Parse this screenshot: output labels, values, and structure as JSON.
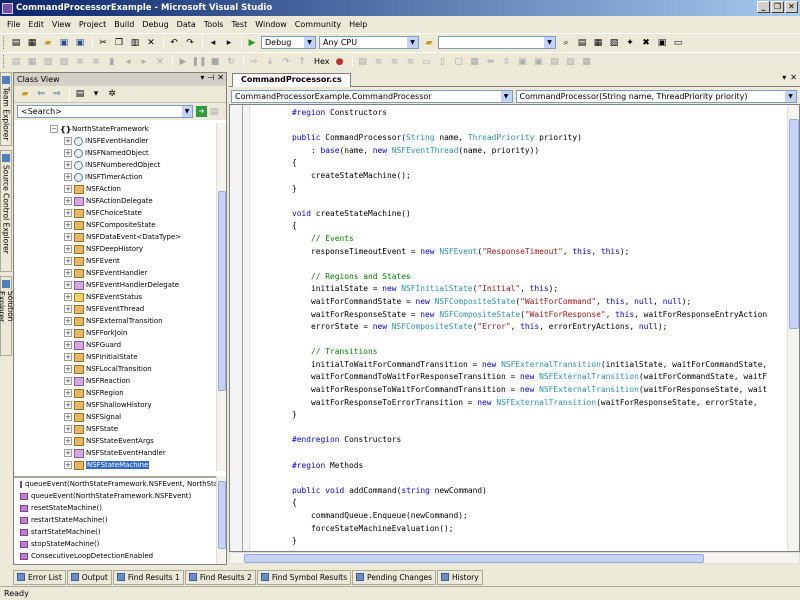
{
  "window": {
    "title": "CommandProcessorExample - Microsoft Visual Studio"
  },
  "menu": [
    "File",
    "Edit",
    "View",
    "Project",
    "Build",
    "Debug",
    "Data",
    "Tools",
    "Test",
    "Window",
    "Community",
    "Help"
  ],
  "toolbar": {
    "configuration": "Debug",
    "platform": "Any CPU",
    "hex_label": "Hex"
  },
  "class_view": {
    "title": "Class View",
    "search_placeholder": "<Search>",
    "namespace": "NorthStateFramework",
    "items": [
      {
        "label": "INSFEventHandler",
        "kind": "iface"
      },
      {
        "label": "INSFNamedObject",
        "kind": "iface"
      },
      {
        "label": "INSFNumberedObject",
        "kind": "iface"
      },
      {
        "label": "INSFTimerAction",
        "kind": "iface"
      },
      {
        "label": "NSFAction",
        "kind": "deleg"
      },
      {
        "label": "NSFActionDelegate",
        "kind": "class"
      },
      {
        "label": "NSFChoiceState",
        "kind": "deleg"
      },
      {
        "label": "NSFCompositeState",
        "kind": "deleg"
      },
      {
        "label": "NSFDataEvent<DataType>",
        "kind": "deleg"
      },
      {
        "label": "NSFDeepHistory",
        "kind": "deleg"
      },
      {
        "label": "NSFEvent",
        "kind": "deleg"
      },
      {
        "label": "NSFEventHandler",
        "kind": "deleg"
      },
      {
        "label": "NSFEventHandlerDelegate",
        "kind": "class"
      },
      {
        "label": "NSFEventStatus",
        "kind": "enum"
      },
      {
        "label": "NSFEventThread",
        "kind": "deleg"
      },
      {
        "label": "NSFExternalTransition",
        "kind": "deleg"
      },
      {
        "label": "NSFForkJoin",
        "kind": "deleg"
      },
      {
        "label": "NSFGuard",
        "kind": "class"
      },
      {
        "label": "NSFInitialState",
        "kind": "deleg"
      },
      {
        "label": "NSFLocalTransition",
        "kind": "deleg"
      },
      {
        "label": "NSFReaction",
        "kind": "class"
      },
      {
        "label": "NSFRegion",
        "kind": "deleg"
      },
      {
        "label": "NSFShallowHistory",
        "kind": "deleg"
      },
      {
        "label": "NSFSignal",
        "kind": "deleg"
      },
      {
        "label": "NSFState",
        "kind": "deleg"
      },
      {
        "label": "NSFStateEventArgs",
        "kind": "deleg"
      },
      {
        "label": "NSFStateEventHandler",
        "kind": "class"
      },
      {
        "label": "NSFStateMachine",
        "kind": "deleg",
        "selected": true
      }
    ],
    "members": [
      "queueEvent(NorthStateFramework.NSFEvent, NorthStateF",
      "queueEvent(NorthStateFramework.NSFEvent)",
      "resetStateMachine()",
      "restartStateMachine()",
      "startStateMachine()",
      "stopStateMachine()",
      "ConsecutiveLoopDetectionEnabled"
    ]
  },
  "side_tabs": [
    "Team Explorer",
    "Source Control Explorer",
    "Solution Explorer"
  ],
  "editor": {
    "tab": "CommandProcessor.cs",
    "type_combo": "CommandProcessorExample.CommandProcessor",
    "member_combo": "CommandProcessor(String name, ThreadPriority priority)",
    "lines": [
      [
        [
          "        ",
          ""
        ],
        [
          "#region",
          "kw"
        ],
        [
          " Constructors",
          ""
        ]
      ],
      [
        [
          "",
          ""
        ]
      ],
      [
        [
          "        ",
          ""
        ],
        [
          "public",
          "kw"
        ],
        [
          " CommandProcessor(",
          ""
        ],
        [
          "String",
          "ty"
        ],
        [
          " name, ",
          ""
        ],
        [
          "ThreadPriority",
          "ty"
        ],
        [
          " priority)",
          ""
        ]
      ],
      [
        [
          "            : ",
          ""
        ],
        [
          "base",
          "kw"
        ],
        [
          "(name, ",
          ""
        ],
        [
          "new",
          "kw"
        ],
        [
          " ",
          ""
        ],
        [
          "NSFEventThread",
          "ty"
        ],
        [
          "(name, priority))",
          ""
        ]
      ],
      [
        [
          "        {",
          ""
        ]
      ],
      [
        [
          "            createStateMachine();",
          ""
        ]
      ],
      [
        [
          "        }",
          ""
        ]
      ],
      [
        [
          "",
          ""
        ]
      ],
      [
        [
          "        ",
          ""
        ],
        [
          "void",
          "kw"
        ],
        [
          " createStateMachine()",
          ""
        ]
      ],
      [
        [
          "        {",
          ""
        ]
      ],
      [
        [
          "            ",
          ""
        ],
        [
          "// Events",
          "cm"
        ]
      ],
      [
        [
          "            responseTimeoutEvent = ",
          ""
        ],
        [
          "new",
          "kw"
        ],
        [
          " ",
          ""
        ],
        [
          "NSFEvent",
          "ty"
        ],
        [
          "(",
          ""
        ],
        [
          "\"ResponseTimeout\"",
          "st"
        ],
        [
          ", ",
          ""
        ],
        [
          "this",
          "kw"
        ],
        [
          ", ",
          ""
        ],
        [
          "this",
          "kw"
        ],
        [
          ");",
          ""
        ]
      ],
      [
        [
          "",
          ""
        ]
      ],
      [
        [
          "            ",
          ""
        ],
        [
          "// Regions and States",
          "cm"
        ]
      ],
      [
        [
          "            initialState = ",
          ""
        ],
        [
          "new",
          "kw"
        ],
        [
          " ",
          ""
        ],
        [
          "NSFInitialState",
          "ty"
        ],
        [
          "(",
          ""
        ],
        [
          "\"Initial\"",
          "st"
        ],
        [
          ", ",
          ""
        ],
        [
          "this",
          "kw"
        ],
        [
          ");",
          ""
        ]
      ],
      [
        [
          "            waitForCommandState = ",
          ""
        ],
        [
          "new",
          "kw"
        ],
        [
          " ",
          ""
        ],
        [
          "NSFCompositeState",
          "ty"
        ],
        [
          "(",
          ""
        ],
        [
          "\"WaitForCommand\"",
          "st"
        ],
        [
          ", ",
          ""
        ],
        [
          "this",
          "kw"
        ],
        [
          ", ",
          ""
        ],
        [
          "null",
          "kw"
        ],
        [
          ", ",
          ""
        ],
        [
          "null",
          "kw"
        ],
        [
          ");",
          ""
        ]
      ],
      [
        [
          "            waitForResponseState = ",
          ""
        ],
        [
          "new",
          "kw"
        ],
        [
          " ",
          ""
        ],
        [
          "NSFCompositeState",
          "ty"
        ],
        [
          "(",
          ""
        ],
        [
          "\"WaitForResponse\"",
          "st"
        ],
        [
          ", ",
          ""
        ],
        [
          "this",
          "kw"
        ],
        [
          ", waitForResponseEntryAction",
          ""
        ]
      ],
      [
        [
          "            errorState = ",
          ""
        ],
        [
          "new",
          "kw"
        ],
        [
          " ",
          ""
        ],
        [
          "NSFCompositeState",
          "ty"
        ],
        [
          "(",
          ""
        ],
        [
          "\"Error\"",
          "st"
        ],
        [
          ", ",
          ""
        ],
        [
          "this",
          "kw"
        ],
        [
          ", errorEntryActions, ",
          ""
        ],
        [
          "null",
          "kw"
        ],
        [
          ");",
          ""
        ]
      ],
      [
        [
          "",
          ""
        ]
      ],
      [
        [
          "            ",
          ""
        ],
        [
          "// Transitions",
          "cm"
        ]
      ],
      [
        [
          "            initialToWaitForCommandTransition = ",
          ""
        ],
        [
          "new",
          "kw"
        ],
        [
          " ",
          ""
        ],
        [
          "NSFExternalTransition",
          "ty"
        ],
        [
          "(initialState, waitForCommandState,",
          ""
        ]
      ],
      [
        [
          "            waitForCommandToWaitForResponseTransition = ",
          ""
        ],
        [
          "new",
          "kw"
        ],
        [
          " ",
          ""
        ],
        [
          "NSFExternalTransition",
          "ty"
        ],
        [
          "(waitForCommandState, waitF",
          ""
        ]
      ],
      [
        [
          "            waitForResponseToWaitForCommandTransition = ",
          ""
        ],
        [
          "new",
          "kw"
        ],
        [
          " ",
          ""
        ],
        [
          "NSFExternalTransition",
          "ty"
        ],
        [
          "(waitForResponseState, wait",
          ""
        ]
      ],
      [
        [
          "            waitForResponseToErrorTransition = ",
          ""
        ],
        [
          "new",
          "kw"
        ],
        [
          " ",
          ""
        ],
        [
          "NSFExternalTransition",
          "ty"
        ],
        [
          "(waitForResponseState, errorState, ",
          ""
        ]
      ],
      [
        [
          "        }",
          ""
        ]
      ],
      [
        [
          "",
          ""
        ]
      ],
      [
        [
          "        ",
          ""
        ],
        [
          "#endregion",
          "kw"
        ],
        [
          " Constructors",
          ""
        ]
      ],
      [
        [
          "",
          ""
        ]
      ],
      [
        [
          "        ",
          ""
        ],
        [
          "#region",
          "kw"
        ],
        [
          " Methods",
          ""
        ]
      ],
      [
        [
          "",
          ""
        ]
      ],
      [
        [
          "        ",
          ""
        ],
        [
          "public",
          "kw"
        ],
        [
          " ",
          ""
        ],
        [
          "void",
          "kw"
        ],
        [
          " addCommand(",
          ""
        ],
        [
          "string",
          "kw"
        ],
        [
          " newCommand)",
          ""
        ]
      ],
      [
        [
          "        {",
          ""
        ]
      ],
      [
        [
          "            commandQueue.Enqueue(newCommand);",
          ""
        ]
      ],
      [
        [
          "            forceStateMachineEvaluation();",
          ""
        ]
      ],
      [
        [
          "        }",
          ""
        ]
      ]
    ]
  },
  "bottom_tabs": [
    "Error List",
    "Output",
    "Find Results 1",
    "Find Results 2",
    "Find Symbol Results",
    "Pending Changes",
    "History"
  ],
  "status": "Ready"
}
